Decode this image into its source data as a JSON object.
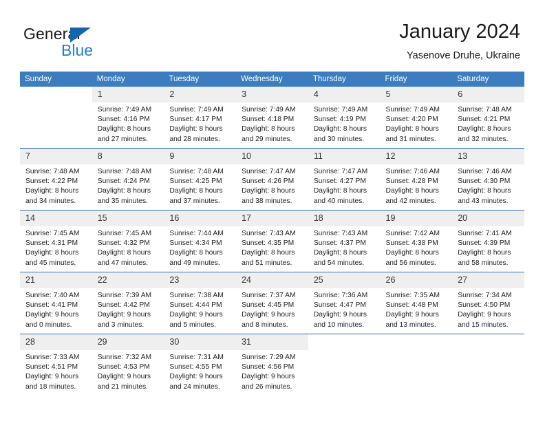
{
  "brand": {
    "word_general": "General",
    "word_blue": "Blue",
    "flag_color": "#1565ad",
    "blue_color": "#1f7fd0"
  },
  "header": {
    "title": "January 2024",
    "subtitle": "Yasenove Druhe, Ukraine"
  },
  "theme": {
    "header_row_bg": "#3b7dbf",
    "row_divider": "#2b6cab",
    "daynum_bg": "#efefef"
  },
  "weekdays": [
    "Sunday",
    "Monday",
    "Tuesday",
    "Wednesday",
    "Thursday",
    "Friday",
    "Saturday"
  ],
  "weeks": [
    [
      {
        "day": "",
        "blank": true
      },
      {
        "day": "1",
        "sunrise": "Sunrise: 7:49 AM",
        "sunset": "Sunset: 4:16 PM",
        "daylight_1": "Daylight: 8 hours",
        "daylight_2": "and 27 minutes."
      },
      {
        "day": "2",
        "sunrise": "Sunrise: 7:49 AM",
        "sunset": "Sunset: 4:17 PM",
        "daylight_1": "Daylight: 8 hours",
        "daylight_2": "and 28 minutes."
      },
      {
        "day": "3",
        "sunrise": "Sunrise: 7:49 AM",
        "sunset": "Sunset: 4:18 PM",
        "daylight_1": "Daylight: 8 hours",
        "daylight_2": "and 29 minutes."
      },
      {
        "day": "4",
        "sunrise": "Sunrise: 7:49 AM",
        "sunset": "Sunset: 4:19 PM",
        "daylight_1": "Daylight: 8 hours",
        "daylight_2": "and 30 minutes."
      },
      {
        "day": "5",
        "sunrise": "Sunrise: 7:49 AM",
        "sunset": "Sunset: 4:20 PM",
        "daylight_1": "Daylight: 8 hours",
        "daylight_2": "and 31 minutes."
      },
      {
        "day": "6",
        "sunrise": "Sunrise: 7:48 AM",
        "sunset": "Sunset: 4:21 PM",
        "daylight_1": "Daylight: 8 hours",
        "daylight_2": "and 32 minutes."
      }
    ],
    [
      {
        "day": "7",
        "sunrise": "Sunrise: 7:48 AM",
        "sunset": "Sunset: 4:22 PM",
        "daylight_1": "Daylight: 8 hours",
        "daylight_2": "and 34 minutes."
      },
      {
        "day": "8",
        "sunrise": "Sunrise: 7:48 AM",
        "sunset": "Sunset: 4:24 PM",
        "daylight_1": "Daylight: 8 hours",
        "daylight_2": "and 35 minutes."
      },
      {
        "day": "9",
        "sunrise": "Sunrise: 7:48 AM",
        "sunset": "Sunset: 4:25 PM",
        "daylight_1": "Daylight: 8 hours",
        "daylight_2": "and 37 minutes."
      },
      {
        "day": "10",
        "sunrise": "Sunrise: 7:47 AM",
        "sunset": "Sunset: 4:26 PM",
        "daylight_1": "Daylight: 8 hours",
        "daylight_2": "and 38 minutes."
      },
      {
        "day": "11",
        "sunrise": "Sunrise: 7:47 AM",
        "sunset": "Sunset: 4:27 PM",
        "daylight_1": "Daylight: 8 hours",
        "daylight_2": "and 40 minutes."
      },
      {
        "day": "12",
        "sunrise": "Sunrise: 7:46 AM",
        "sunset": "Sunset: 4:28 PM",
        "daylight_1": "Daylight: 8 hours",
        "daylight_2": "and 42 minutes."
      },
      {
        "day": "13",
        "sunrise": "Sunrise: 7:46 AM",
        "sunset": "Sunset: 4:30 PM",
        "daylight_1": "Daylight: 8 hours",
        "daylight_2": "and 43 minutes."
      }
    ],
    [
      {
        "day": "14",
        "sunrise": "Sunrise: 7:45 AM",
        "sunset": "Sunset: 4:31 PM",
        "daylight_1": "Daylight: 8 hours",
        "daylight_2": "and 45 minutes."
      },
      {
        "day": "15",
        "sunrise": "Sunrise: 7:45 AM",
        "sunset": "Sunset: 4:32 PM",
        "daylight_1": "Daylight: 8 hours",
        "daylight_2": "and 47 minutes."
      },
      {
        "day": "16",
        "sunrise": "Sunrise: 7:44 AM",
        "sunset": "Sunset: 4:34 PM",
        "daylight_1": "Daylight: 8 hours",
        "daylight_2": "and 49 minutes."
      },
      {
        "day": "17",
        "sunrise": "Sunrise: 7:43 AM",
        "sunset": "Sunset: 4:35 PM",
        "daylight_1": "Daylight: 8 hours",
        "daylight_2": "and 51 minutes."
      },
      {
        "day": "18",
        "sunrise": "Sunrise: 7:43 AM",
        "sunset": "Sunset: 4:37 PM",
        "daylight_1": "Daylight: 8 hours",
        "daylight_2": "and 54 minutes."
      },
      {
        "day": "19",
        "sunrise": "Sunrise: 7:42 AM",
        "sunset": "Sunset: 4:38 PM",
        "daylight_1": "Daylight: 8 hours",
        "daylight_2": "and 56 minutes."
      },
      {
        "day": "20",
        "sunrise": "Sunrise: 7:41 AM",
        "sunset": "Sunset: 4:39 PM",
        "daylight_1": "Daylight: 8 hours",
        "daylight_2": "and 58 minutes."
      }
    ],
    [
      {
        "day": "21",
        "sunrise": "Sunrise: 7:40 AM",
        "sunset": "Sunset: 4:41 PM",
        "daylight_1": "Daylight: 9 hours",
        "daylight_2": "and 0 minutes."
      },
      {
        "day": "22",
        "sunrise": "Sunrise: 7:39 AM",
        "sunset": "Sunset: 4:42 PM",
        "daylight_1": "Daylight: 9 hours",
        "daylight_2": "and 3 minutes."
      },
      {
        "day": "23",
        "sunrise": "Sunrise: 7:38 AM",
        "sunset": "Sunset: 4:44 PM",
        "daylight_1": "Daylight: 9 hours",
        "daylight_2": "and 5 minutes."
      },
      {
        "day": "24",
        "sunrise": "Sunrise: 7:37 AM",
        "sunset": "Sunset: 4:45 PM",
        "daylight_1": "Daylight: 9 hours",
        "daylight_2": "and 8 minutes."
      },
      {
        "day": "25",
        "sunrise": "Sunrise: 7:36 AM",
        "sunset": "Sunset: 4:47 PM",
        "daylight_1": "Daylight: 9 hours",
        "daylight_2": "and 10 minutes."
      },
      {
        "day": "26",
        "sunrise": "Sunrise: 7:35 AM",
        "sunset": "Sunset: 4:48 PM",
        "daylight_1": "Daylight: 9 hours",
        "daylight_2": "and 13 minutes."
      },
      {
        "day": "27",
        "sunrise": "Sunrise: 7:34 AM",
        "sunset": "Sunset: 4:50 PM",
        "daylight_1": "Daylight: 9 hours",
        "daylight_2": "and 15 minutes."
      }
    ],
    [
      {
        "day": "28",
        "sunrise": "Sunrise: 7:33 AM",
        "sunset": "Sunset: 4:51 PM",
        "daylight_1": "Daylight: 9 hours",
        "daylight_2": "and 18 minutes."
      },
      {
        "day": "29",
        "sunrise": "Sunrise: 7:32 AM",
        "sunset": "Sunset: 4:53 PM",
        "daylight_1": "Daylight: 9 hours",
        "daylight_2": "and 21 minutes."
      },
      {
        "day": "30",
        "sunrise": "Sunrise: 7:31 AM",
        "sunset": "Sunset: 4:55 PM",
        "daylight_1": "Daylight: 9 hours",
        "daylight_2": "and 24 minutes."
      },
      {
        "day": "31",
        "sunrise": "Sunrise: 7:29 AM",
        "sunset": "Sunset: 4:56 PM",
        "daylight_1": "Daylight: 9 hours",
        "daylight_2": "and 26 minutes."
      },
      {
        "day": "",
        "blank": true
      },
      {
        "day": "",
        "blank": true
      },
      {
        "day": "",
        "blank": true
      }
    ]
  ]
}
